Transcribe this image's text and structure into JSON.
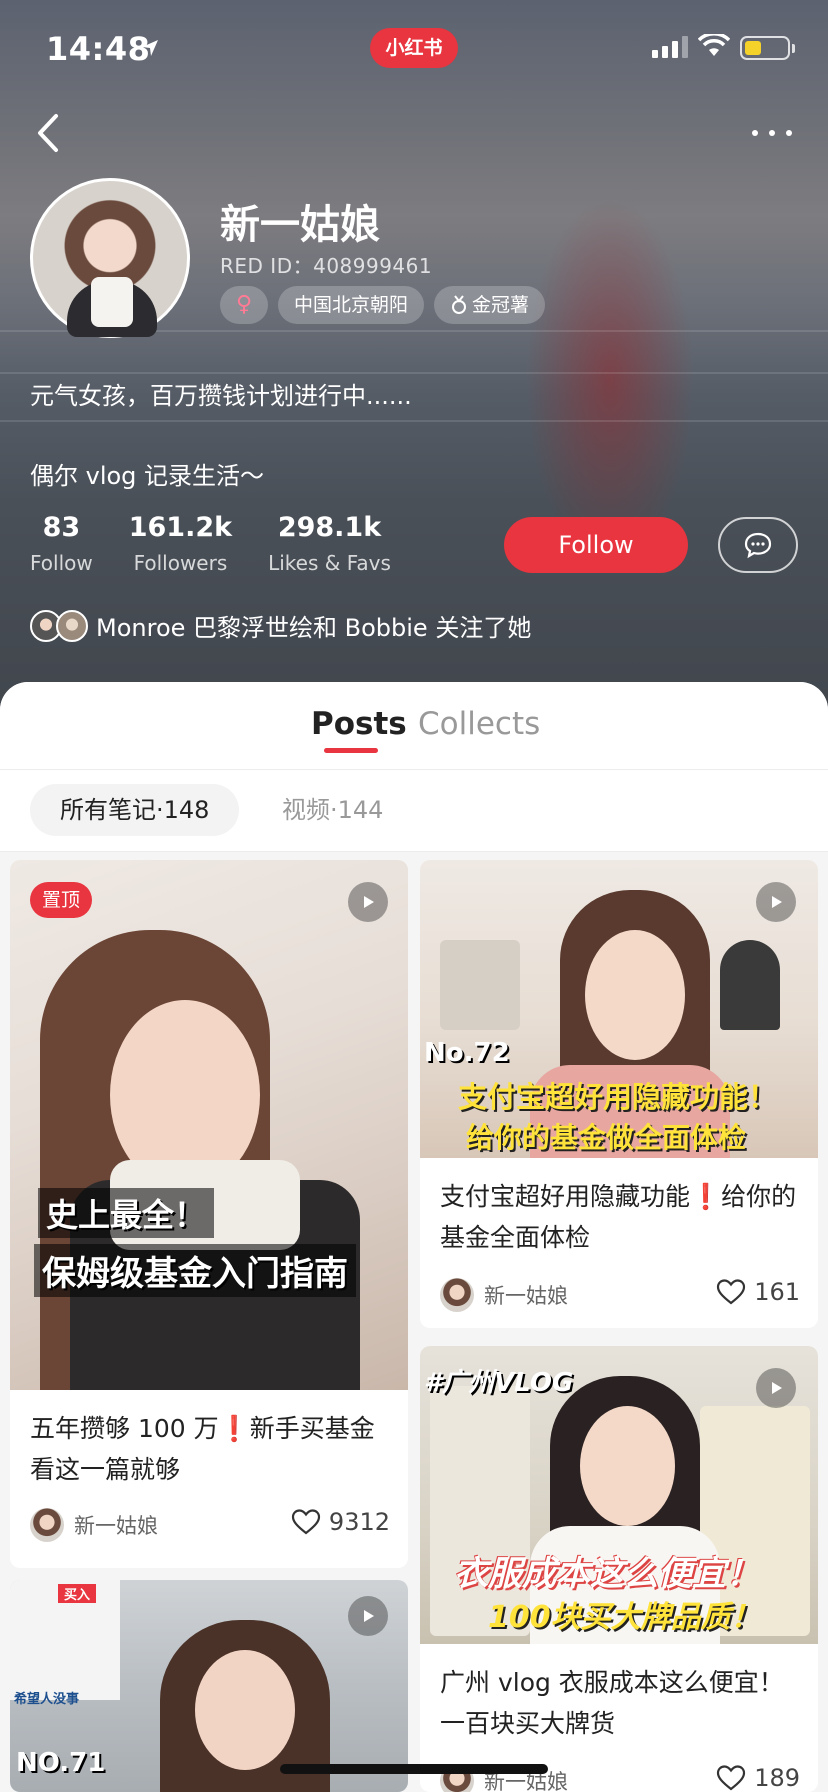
{
  "status_bar": {
    "time": "14:48",
    "app_badge": "小红书"
  },
  "profile": {
    "name": "新一姑娘",
    "red_id": "RED ID：408999461",
    "gender_symbol": "♀",
    "location": "中国北京朝阳",
    "badge": "金冠薯",
    "bio_line1": "元气女孩，百万攒钱计划进行中......",
    "bio_line2": "偶尔 vlog 记录生活～",
    "stats": [
      {
        "value": "83",
        "label": "Follow"
      },
      {
        "value": "161.2k",
        "label": "Followers"
      },
      {
        "value": "298.1k",
        "label": "Likes & Favs"
      }
    ],
    "follow_label": "Follow",
    "mutual_text": "Monroe 巴黎浮世绘和 Bobbie 关注了她"
  },
  "tabs": [
    {
      "label": "Posts"
    },
    {
      "label": "Collects"
    }
  ],
  "filters": {
    "all_notes": "所有笔记·148",
    "videos": "视频·144"
  },
  "posts": [
    {
      "pin": "置顶",
      "overlay_line1": "史上最全！",
      "overlay_line2": "保姆级基金入门指南",
      "title": "五年攒够 100 万❗️新手买基金看这一篇就够",
      "author": "新一姑娘",
      "likes": "9312"
    },
    {
      "overlay_no": "No.72",
      "overlay_line1": "支付宝超好用隐藏功能！",
      "overlay_line2": "给你的基金做全面体检",
      "title": "支付宝超好用隐藏功能❗️给你的基金全面体检",
      "author": "新一姑娘",
      "likes": "161"
    },
    {
      "overlay_tag": "#广州VLOG",
      "overlay_line1": "衣服成本这么便宜！",
      "overlay_line2": "100块买大牌品质！",
      "title": "广州 vlog 衣服成本这么便宜！一百块买大牌货",
      "author": "新一姑娘",
      "likes": "189"
    },
    {
      "overlay_buy": "买入",
      "overlay_hope": "希望人没事",
      "overlay_no": "NO.71"
    }
  ]
}
